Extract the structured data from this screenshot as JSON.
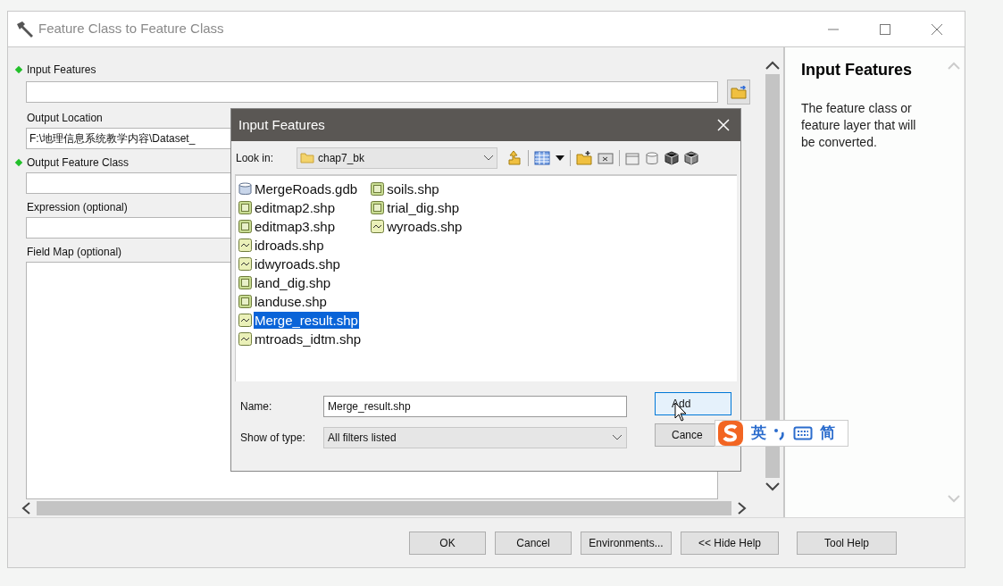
{
  "window": {
    "title": "Feature Class to Feature Class"
  },
  "parameters": [
    {
      "label": "Input Features",
      "required": true,
      "kind": "field"
    },
    {
      "label": "Output Location",
      "required": false,
      "kind": "field",
      "value": "F:\\地理信息系统教学内容\\Dataset_"
    },
    {
      "label": "Output Feature Class",
      "required": true,
      "kind": "field"
    },
    {
      "label": "Expression (optional)",
      "required": false,
      "kind": "field"
    },
    {
      "label": "Field Map (optional)",
      "required": false,
      "kind": "box"
    }
  ],
  "help": {
    "title": "Input Features",
    "text": "The feature class or feature layer that will be converted."
  },
  "buttons": [
    "OK",
    "Cancel",
    "Environments...",
    "<< Hide Help",
    "Tool Help"
  ],
  "dialog": {
    "title": "Input Features",
    "look_in_label": "Look in:",
    "look_in": "chap7_bk",
    "files": [
      {
        "name": "MergeRoads.gdb",
        "kind": "geodatabase",
        "selected": false
      },
      {
        "name": "editmap2.shp",
        "kind": "polygon",
        "selected": false
      },
      {
        "name": "editmap3.shp",
        "kind": "polygon",
        "selected": false
      },
      {
        "name": "idroads.shp",
        "kind": "line",
        "selected": false
      },
      {
        "name": "idwyroads.shp",
        "kind": "line",
        "selected": false
      },
      {
        "name": "land_dig.shp",
        "kind": "polygon",
        "selected": false
      },
      {
        "name": "landuse.shp",
        "kind": "polygon",
        "selected": false
      },
      {
        "name": "Merge_result.shp",
        "kind": "line",
        "selected": true
      },
      {
        "name": "mtroads_idtm.shp",
        "kind": "line",
        "selected": false
      },
      {
        "name": "soils.shp",
        "kind": "polygon",
        "selected": false
      },
      {
        "name": "trial_dig.shp",
        "kind": "polygon",
        "selected": false
      },
      {
        "name": "wyroads.shp",
        "kind": "line",
        "selected": false
      }
    ],
    "name_label": "Name:",
    "name_value": "Merge_result.shp",
    "type_label": "Show of type:",
    "type_value": "All filters listed",
    "buttons": [
      "Add",
      "Cance"
    ]
  },
  "ime": {
    "language": "英",
    "script": "简"
  }
}
